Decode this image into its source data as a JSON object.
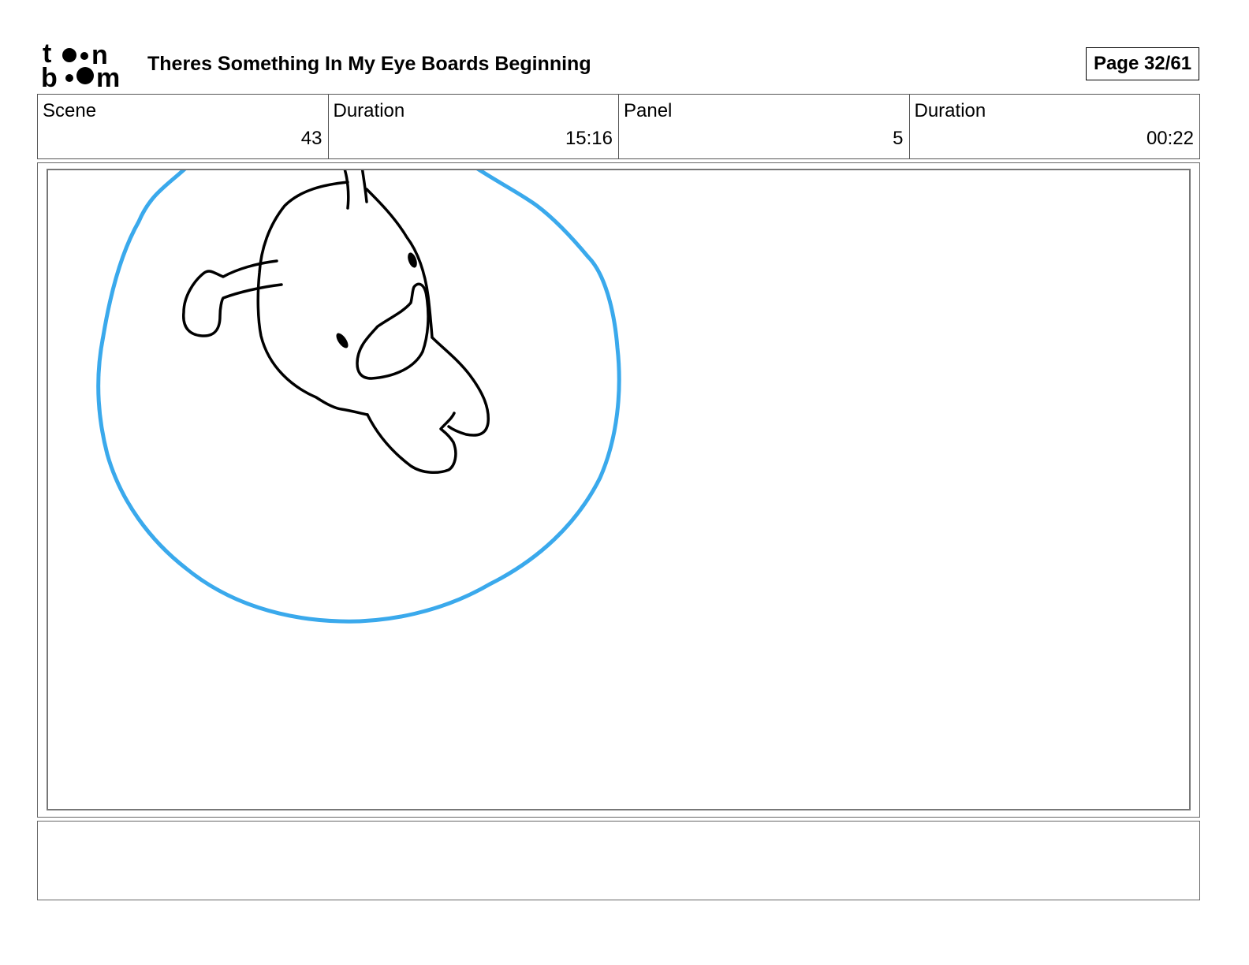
{
  "header": {
    "logo_text": "toonboom",
    "title": "Theres Something In My Eye Boards Beginning",
    "page_label": "Page 32/61"
  },
  "info": [
    {
      "label": "Scene",
      "value": "43"
    },
    {
      "label": "Duration",
      "value": "15:16"
    },
    {
      "label": "Panel",
      "value": "5"
    },
    {
      "label": "Duration",
      "value": "00:22"
    }
  ],
  "panel": {
    "circle_color": "#3aa9ec",
    "line_color": "#000000"
  },
  "notes": {
    "text": ""
  }
}
